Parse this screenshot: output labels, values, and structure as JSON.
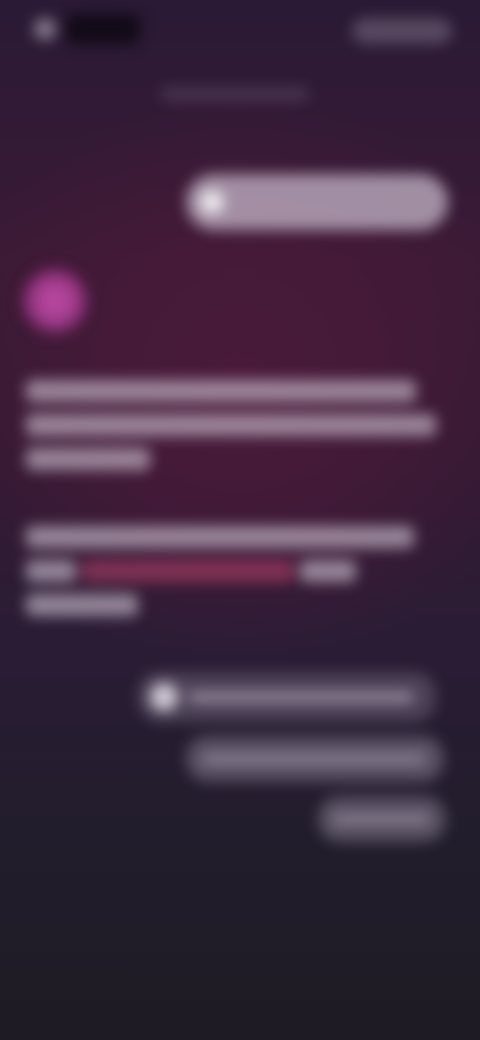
{
  "topbar": {
    "title": "",
    "action_label": "",
    "back_icon": "back-icon"
  },
  "conversation": {
    "timestamp": "",
    "user_message": {
      "icon": "image-icon",
      "text": ""
    },
    "assistant": {
      "avatar_color": "#b5449d",
      "paragraph_1": "",
      "paragraph_2": "",
      "link_text": ""
    }
  },
  "suggestions": [
    {
      "label": "",
      "icon": "audio-icon"
    },
    {
      "label": ""
    },
    {
      "label": ""
    }
  ],
  "colors": {
    "background_top": "#2a1a35",
    "background_mid": "#3a1a35",
    "background_bottom": "#1e1b24",
    "link": "#be466e"
  }
}
